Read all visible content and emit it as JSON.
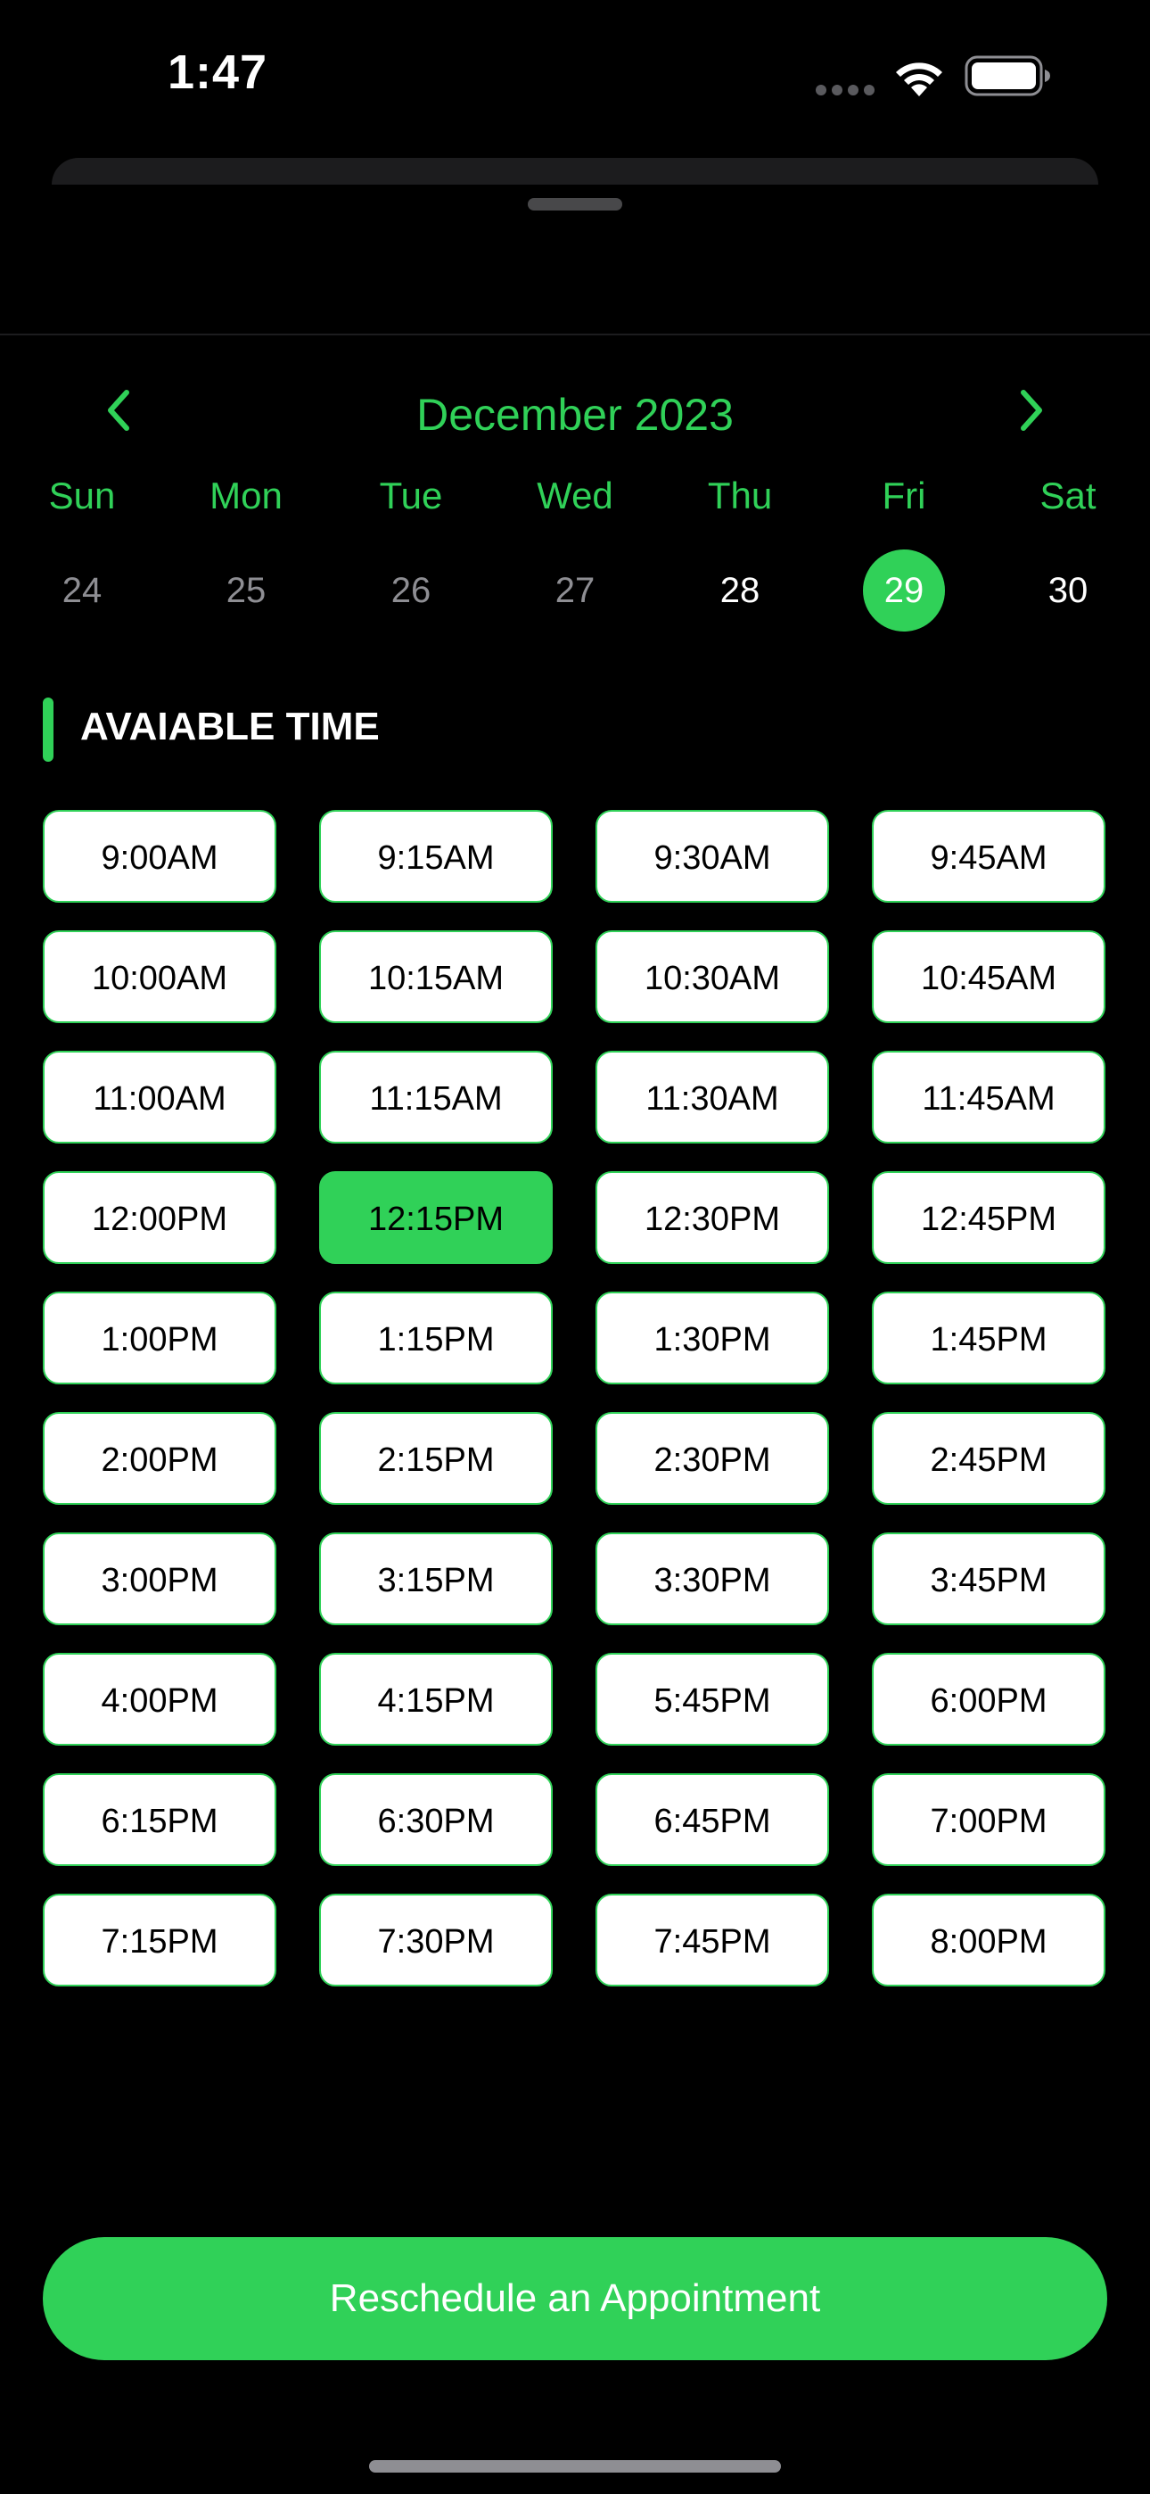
{
  "status_bar": {
    "time": "1:47",
    "icons": [
      "signal-icon",
      "wifi-icon",
      "battery-icon"
    ]
  },
  "calendar": {
    "month_title": "December 2023",
    "prev_icon": "chevron-left-icon",
    "next_icon": "chevron-right-icon",
    "weekdays": [
      "Sun",
      "Mon",
      "Tue",
      "Wed",
      "Thu",
      "Fri",
      "Sat"
    ],
    "dates": [
      {
        "label": "24",
        "state": "past"
      },
      {
        "label": "25",
        "state": "past"
      },
      {
        "label": "26",
        "state": "past"
      },
      {
        "label": "27",
        "state": "past"
      },
      {
        "label": "28",
        "state": "future"
      },
      {
        "label": "29",
        "state": "selected"
      },
      {
        "label": "30",
        "state": "future"
      }
    ]
  },
  "available_time": {
    "title": "AVAIABLE TIME",
    "selected": "12:15PM",
    "slots": [
      "9:00AM",
      "9:15AM",
      "9:30AM",
      "9:45AM",
      "10:00AM",
      "10:15AM",
      "10:30AM",
      "10:45AM",
      "11:00AM",
      "11:15AM",
      "11:30AM",
      "11:45AM",
      "12:00PM",
      "12:15PM",
      "12:30PM",
      "12:45PM",
      "1:00PM",
      "1:15PM",
      "1:30PM",
      "1:45PM",
      "2:00PM",
      "2:15PM",
      "2:30PM",
      "2:45PM",
      "3:00PM",
      "3:15PM",
      "3:30PM",
      "3:45PM",
      "4:00PM",
      "4:15PM",
      "5:45PM",
      "6:00PM",
      "6:15PM",
      "6:30PM",
      "6:45PM",
      "7:00PM",
      "7:15PM",
      "7:30PM",
      "7:45PM",
      "8:00PM"
    ]
  },
  "actions": {
    "reschedule_label": "Reschedule an Appointment"
  },
  "colors": {
    "accent": "#30d158",
    "background": "#000000",
    "slot_background": "#ffffff",
    "muted_text": "#8e8e93"
  }
}
